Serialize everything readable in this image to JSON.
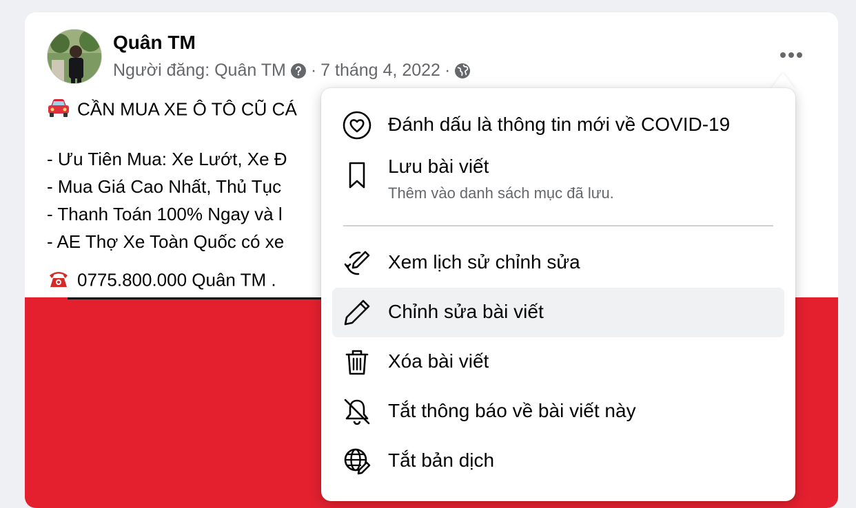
{
  "post": {
    "author": "Quân TM",
    "meta_prefix": "Người đăng: Quân TM",
    "meta_sep1": "·",
    "date": "7 tháng 4, 2022",
    "meta_sep2": "·",
    "lines": [
      "CẦN MUA XE Ô TÔ CŨ CÁ",
      "- Ưu Tiên Mua: Xe Lướt, Xe Đ",
      "- Mua Giá Cao Nhất, Thủ Tục",
      "- Thanh Toán 100% Ngay và l",
      "- AE Thợ Xe Toàn Quốc có xe",
      "0775.800.000 Quân TM ."
    ],
    "image_color": "#e4202f"
  },
  "menu": {
    "items": [
      {
        "label": "Đánh dấu là thông tin mới về COVID-19",
        "icon": "heart-bubble-icon"
      },
      {
        "label": "Lưu bài viết",
        "sub": "Thêm vào danh sách mục đã lưu.",
        "icon": "bookmark-icon"
      },
      {
        "label": "Xem lịch sử chỉnh sửa",
        "icon": "edit-history-icon"
      },
      {
        "label": "Chỉnh sửa bài viết",
        "icon": "pencil-icon"
      },
      {
        "label": "Xóa bài viết",
        "icon": "trash-icon"
      },
      {
        "label": "Tắt thông báo về bài viết này",
        "icon": "bell-off-icon"
      },
      {
        "label": "Tắt bản dịch",
        "icon": "translate-icon"
      }
    ]
  },
  "colors": {
    "accent_red": "#e4202f",
    "secondary_text": "#65676b",
    "highlight": "#f0f1f2"
  }
}
